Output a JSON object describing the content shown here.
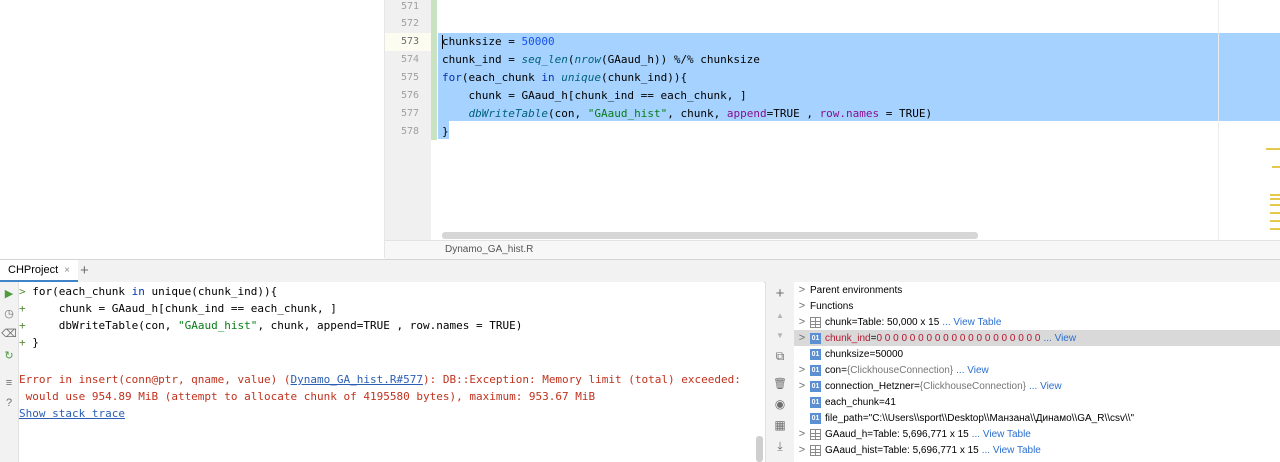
{
  "editor": {
    "line_numbers": [
      "571",
      "572",
      "573",
      "574",
      "575",
      "576",
      "577",
      "578"
    ],
    "code": {
      "l573": {
        "a": "chunksize = ",
        "b": "50000"
      },
      "l574": {
        "a": "chunk_ind = ",
        "fn1": "seq_len",
        "p1": "(",
        "fn2": "nrow",
        "p2": "(GAaud_h)) %/% chunksize"
      },
      "l575": {
        "kw1": "for",
        "a": "(each_chunk ",
        "kw2": "in",
        "b": " ",
        "fn": "unique",
        "c": "(chunk_ind)){"
      },
      "l576": {
        "a": "    chunk = GAaud_h[chunk_ind == each_chunk, ]"
      },
      "l577": {
        "indent": "    ",
        "fn": "dbWriteTable",
        "a": "(con, ",
        "str": "\"GAaud_hist\"",
        "b": ", chunk, ",
        "n1": "append",
        "c": "=TRUE , ",
        "n2": "row.names",
        "d": " = TRUE)"
      },
      "l578": {
        "a": "}"
      }
    },
    "file_tab": "Dynamo_GA_hist.R"
  },
  "tool_window": {
    "tab_label": "CHProject",
    "tab_close": "×",
    "add_tab": "+"
  },
  "console": {
    "lines": {
      "c1": {
        "prompt": ">",
        "a": " for(each_chunk ",
        "kw": "in",
        "b": " unique(chunk_ind)){"
      },
      "c2": {
        "prompt": "+",
        "a": "     chunk = GAaud_h[chunk_ind == each_chunk, ]"
      },
      "c3": {
        "prompt": "+",
        "a": "     dbWriteTable(con, ",
        "str": "\"GAaud_hist\"",
        "b": ", chunk, append=TRUE , row.names = TRUE)"
      },
      "c4": {
        "prompt": "+",
        "a": " }"
      }
    },
    "error": {
      "pre": "Error in insert(conn@ptr, qname, value) (",
      "link": "Dynamo_GA_hist.R#577",
      "post": "): DB::Exception: Memory limit (total) exceeded:",
      "line2": " would use 954.89 MiB (attempt to allocate chunk of 4195580 bytes), maximum: 953.67 MiB"
    },
    "stack_trace": "Show stack trace"
  },
  "variables": {
    "rows": [
      {
        "name": "Parent environments",
        "chev": ">",
        "icon": "none"
      },
      {
        "name": "Functions",
        "chev": ">",
        "icon": "none"
      },
      {
        "name": "chunk",
        "eq": " = ",
        "value": "Table: 50,000 x 15",
        "link": "... View Table",
        "chev": ">",
        "icon": "table"
      },
      {
        "name": "chunk_ind",
        "eq": " = ",
        "value": "0 0 0 0 0 0 0 0 0 0 0 0 0 0 0 0 0 0 0 0",
        "link": "... View",
        "chev": ">",
        "icon": "01"
      },
      {
        "name": "chunksize",
        "eq": " = ",
        "value": "50000",
        "link": "",
        "chev": "",
        "icon": "01"
      },
      {
        "name": "con",
        "eq": " = ",
        "value": "{ClickhouseConnection}",
        "link": "... View",
        "chev": ">",
        "icon": "01"
      },
      {
        "name": "connection_Hetzner",
        "eq": " = ",
        "value": "{ClickhouseConnection}",
        "link": "... View",
        "chev": ">",
        "icon": "01"
      },
      {
        "name": "each_chunk",
        "eq": " = ",
        "value": "41",
        "link": "",
        "chev": "",
        "icon": "01"
      },
      {
        "name": "file_path",
        "eq": " = ",
        "value": "\"C:\\\\Users\\\\sport\\\\Desktop\\\\Манзана\\\\Динамо\\\\GA_R\\\\csv\\\\\"",
        "link": "",
        "chev": "",
        "icon": "01"
      },
      {
        "name": "GAaud_h",
        "eq": " = ",
        "value": "Table: 5,696,771 x 15",
        "link": "... View Table",
        "chev": ">",
        "icon": "table"
      },
      {
        "name": "GAaud_hist",
        "eq": " = ",
        "value": "Table: 5,696,771 x 15",
        "link": "... View Table",
        "chev": ">",
        "icon": "table"
      }
    ]
  },
  "icons": {
    "run": "▶",
    "history": "◷",
    "clear": "⌫",
    "rerun": "↻",
    "softwrap": "≡",
    "help": "?",
    "add": "+",
    "up": "▲",
    "down": "▼",
    "copy": "⧉",
    "delete": "🗑",
    "view": "◉",
    "table": "▦",
    "sort": "⤓"
  },
  "colors": {
    "selection": "#a6d2ff",
    "keyword": "#0033b3",
    "number": "#1750eb",
    "string": "#067d17",
    "error": "#c0321e",
    "link": "#2b5fb4"
  }
}
